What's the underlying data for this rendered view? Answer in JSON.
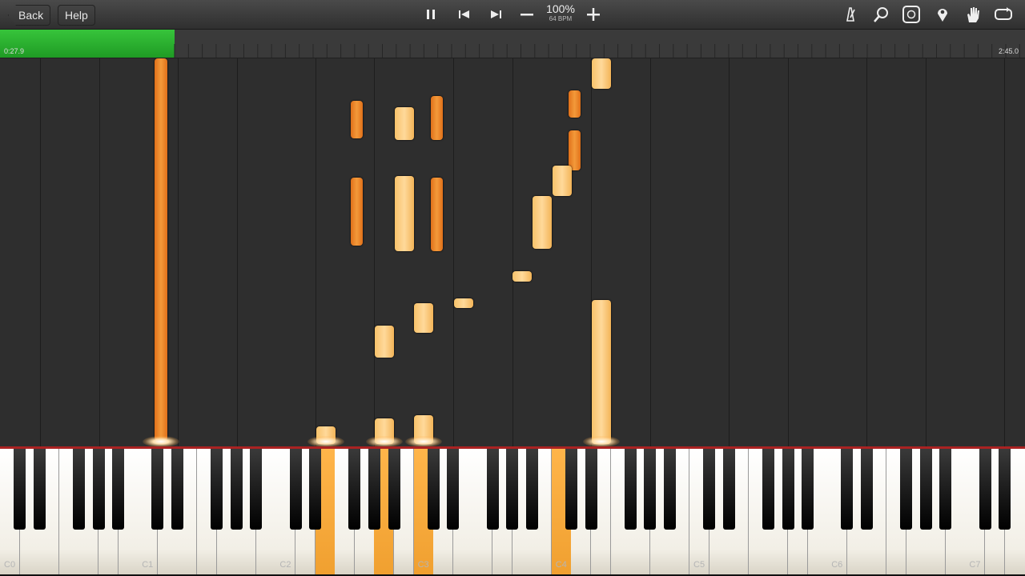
{
  "toolbar": {
    "back_label": "Back",
    "help_label": "Help",
    "zoom_percent": "100%",
    "tempo_bpm": "64 BPM"
  },
  "progress": {
    "elapsed": "0:27.9",
    "total": "2:45.0",
    "fraction": 0.17
  },
  "keyboard": {
    "octave_labels": [
      "C0",
      "C1",
      "C2",
      "C3",
      "C4",
      "C5",
      "C6",
      "C7"
    ]
  },
  "colors": {
    "progress_green": "#2db33a",
    "note_dark": "#e87f22",
    "note_light": "#ffcf86",
    "playhead_red": "#a22222"
  }
}
